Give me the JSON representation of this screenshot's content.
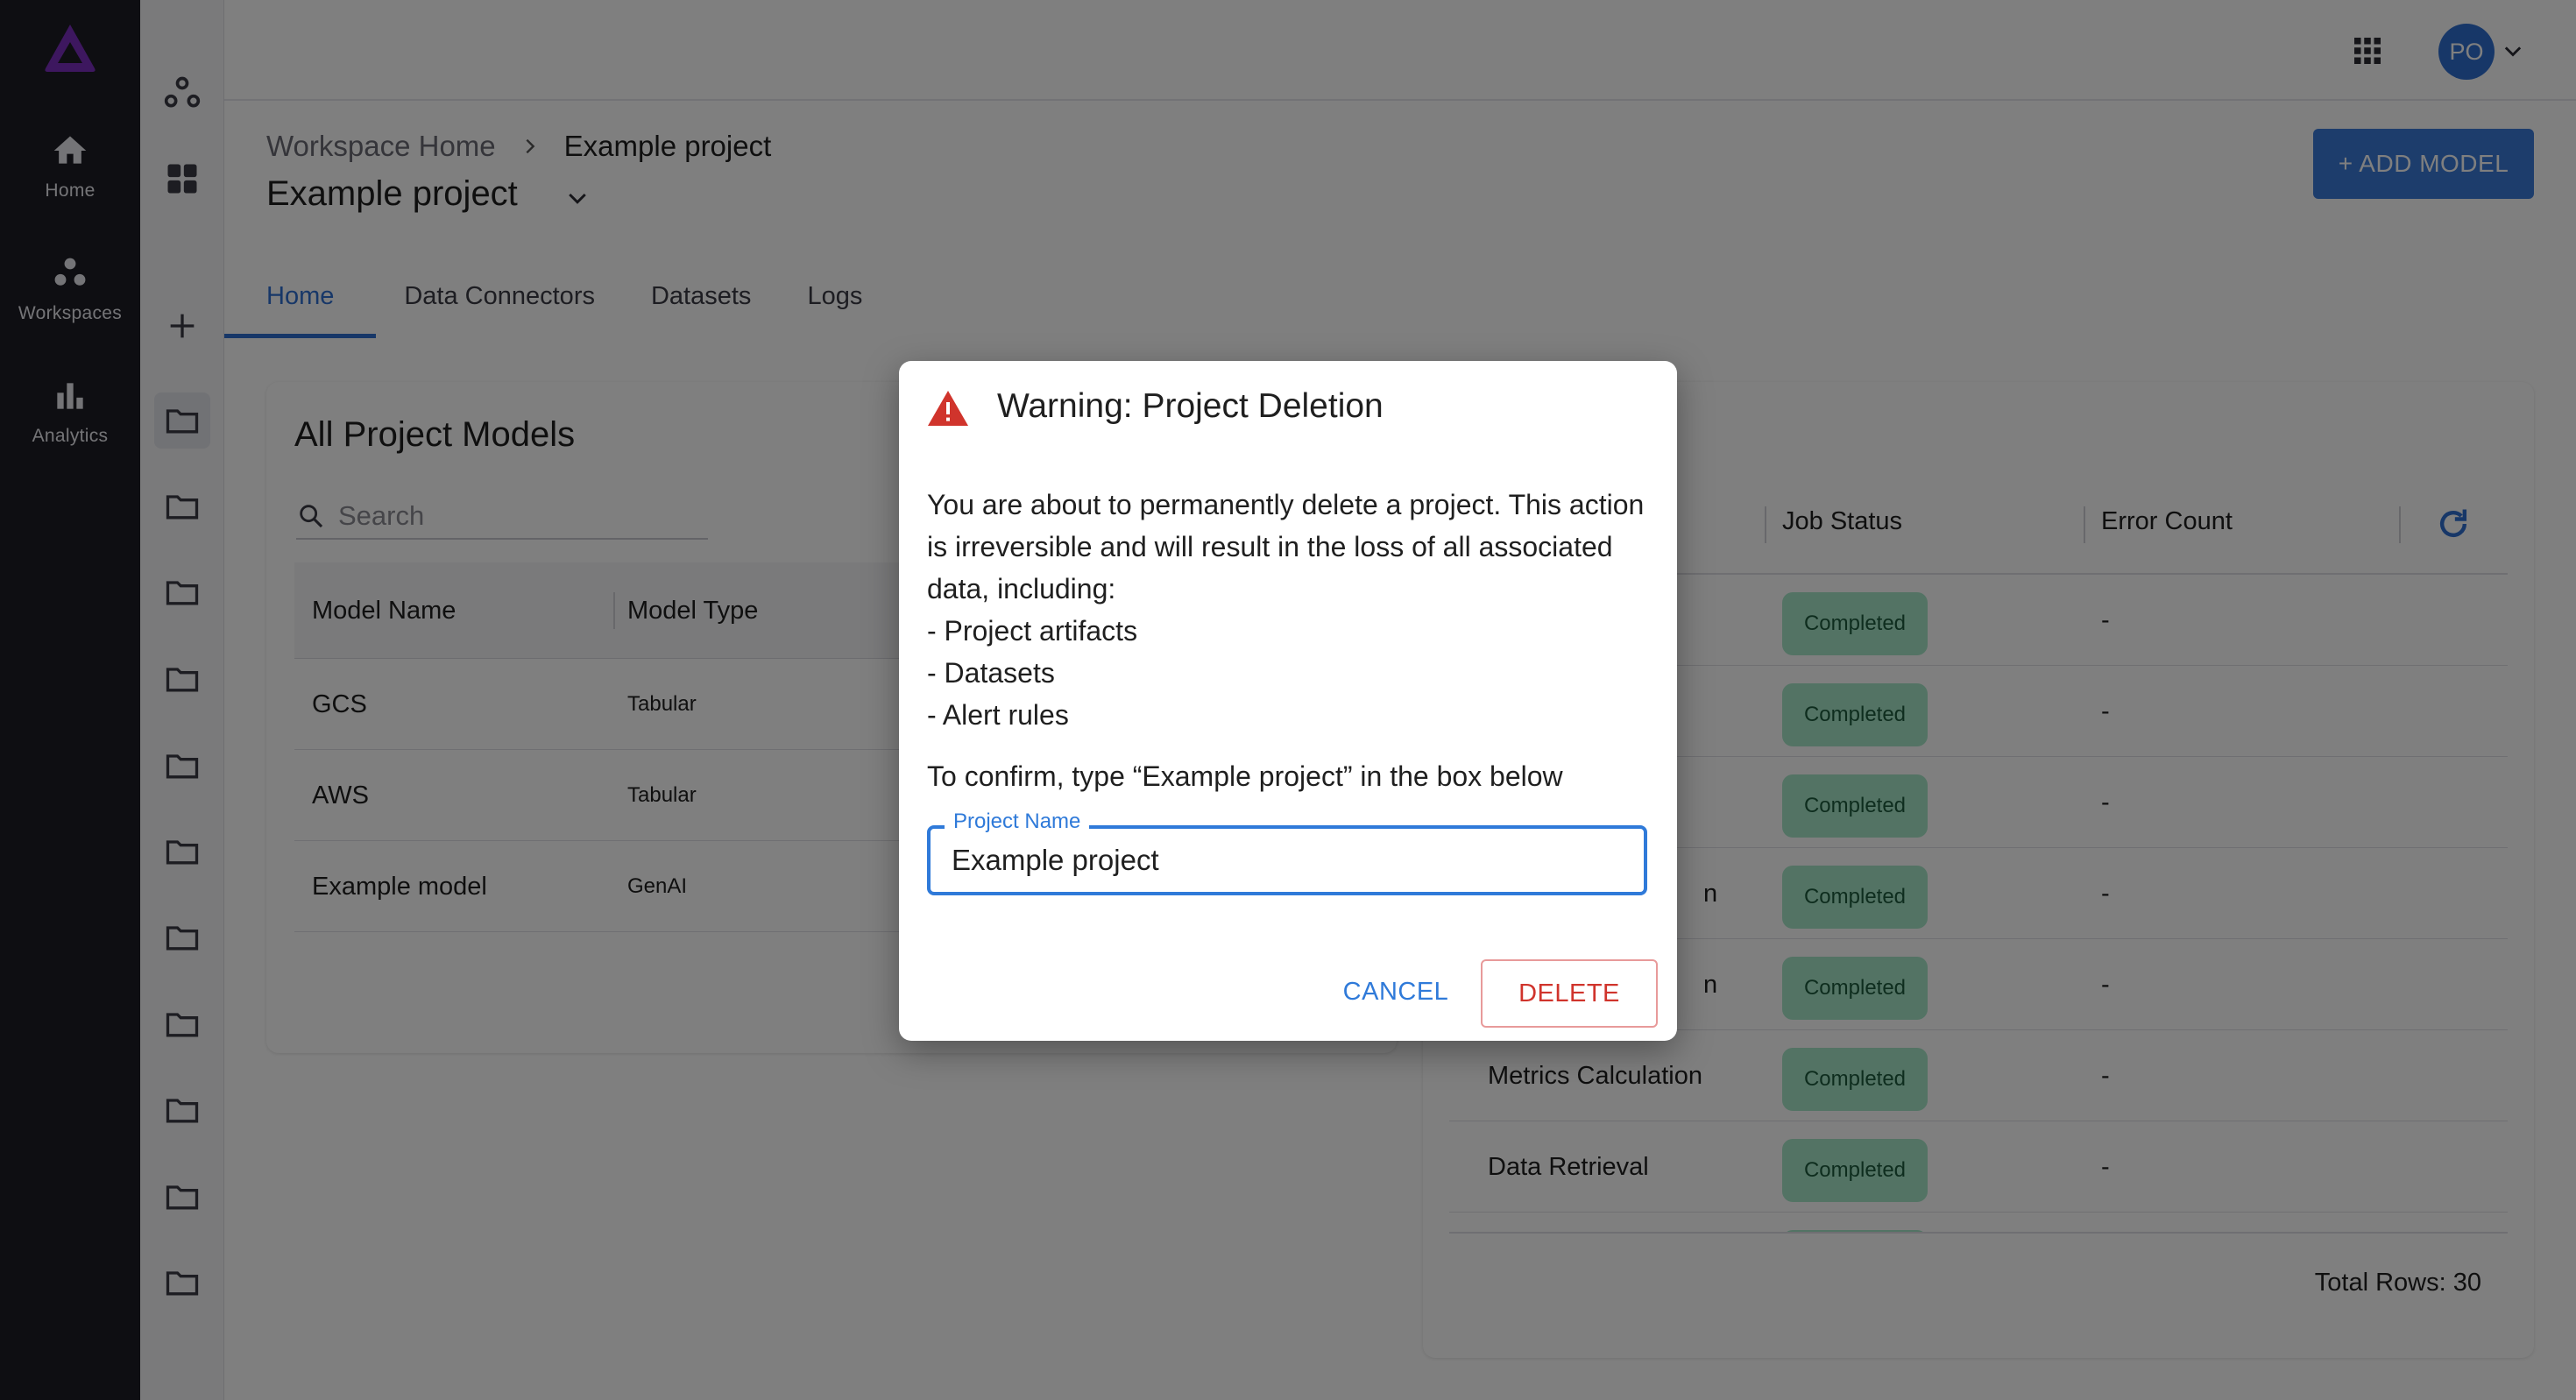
{
  "nav": {
    "items": [
      {
        "label": "Home",
        "icon": "home-icon"
      },
      {
        "label": "Workspaces",
        "icon": "workspaces-icon"
      },
      {
        "label": "Analytics",
        "icon": "analytics-icon"
      }
    ]
  },
  "topbar": {
    "avatar_initials": "PO"
  },
  "header": {
    "breadcrumb_root": "Workspace Home",
    "breadcrumb_current": "Example project",
    "title": "Example project",
    "add_model_label": "+ ADD MODEL"
  },
  "tabs": [
    {
      "label": "Home",
      "active": true
    },
    {
      "label": "Data Connectors",
      "active": false
    },
    {
      "label": "Datasets",
      "active": false
    },
    {
      "label": "Logs",
      "active": false
    }
  ],
  "models_card": {
    "title": "All Project Models",
    "search_placeholder": "Search",
    "columns": [
      "Model Name",
      "Model Type"
    ],
    "rows": [
      {
        "name": "GCS",
        "type": "Tabular"
      },
      {
        "name": "AWS",
        "type": "Tabular"
      },
      {
        "name": "Example model",
        "type": "GenAI"
      }
    ]
  },
  "jobs_card": {
    "columns": [
      "Job Status",
      "Error Count"
    ],
    "rows": [
      {
        "name": "",
        "status": "Completed",
        "errors": "-"
      },
      {
        "name": "",
        "status": "Completed",
        "errors": "-"
      },
      {
        "name": "",
        "status": "Completed",
        "errors": "-"
      },
      {
        "name": "n",
        "status": "Completed",
        "errors": "-"
      },
      {
        "name": "n",
        "status": "Completed",
        "errors": "-"
      },
      {
        "name": "Metrics Calculation",
        "status": "Completed",
        "errors": "-"
      },
      {
        "name": "Data Retrieval",
        "status": "Completed",
        "errors": "-"
      }
    ],
    "total_rows": "Total Rows: 30"
  },
  "dialog": {
    "title": "Warning: Project Deletion",
    "body_intro": "You are about to permanently delete a project. This action is irreversible and will result in the loss of all associated data, including:",
    "items": [
      "- Project artifacts",
      "- Datasets",
      "- Alert rules"
    ],
    "confirm_text": "To confirm, type “Example project” in the box below",
    "field_label": "Project Name",
    "field_value": "Example project",
    "cancel_label": "CANCEL",
    "delete_label": "DELETE"
  },
  "colors": {
    "accent": "#2f6fd1",
    "danger": "#d0342c",
    "status_completed_bg": "#a7e6c9",
    "rail_bg": "#1d1d24",
    "logo": "#7b2fbf"
  }
}
